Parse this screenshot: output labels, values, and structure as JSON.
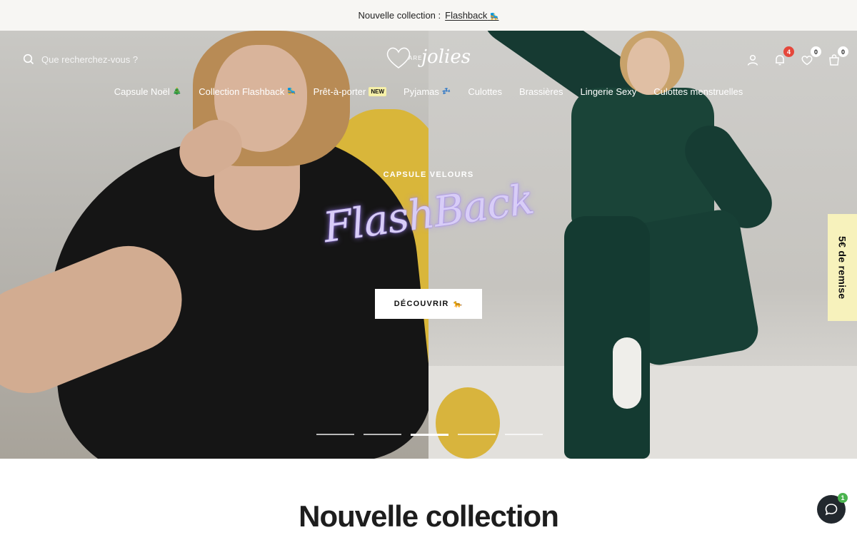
{
  "announcement": {
    "prefix": "Nouvelle collection :",
    "link": "Flashback",
    "link_emoji": "🛼"
  },
  "header": {
    "search_placeholder": "Que recherchez-vous ?",
    "logo_small": "ARE",
    "logo_script": "jolies",
    "icons": [
      {
        "name": "account-icon"
      },
      {
        "name": "notification-icon",
        "badge": "4"
      },
      {
        "name": "wishlist-icon",
        "badge": "0"
      },
      {
        "name": "cart-icon",
        "badge": "0"
      }
    ]
  },
  "nav": {
    "items": [
      {
        "label": "Capsule Noël",
        "emoji": "🎄"
      },
      {
        "label": "Collection Flashback",
        "emoji": "🛼"
      },
      {
        "label": "Prêt-à-porter",
        "tag": "NEW"
      },
      {
        "label": "Pyjamas",
        "emoji": "💤"
      },
      {
        "label": "Culottes"
      },
      {
        "label": "Brassières"
      },
      {
        "label": "Lingerie Sexy"
      },
      {
        "label": "Culottes menstruelles"
      }
    ]
  },
  "hero": {
    "eyebrow": "CAPSULE VELOURS",
    "title": "FlashBack",
    "cta_label": "DÉCOUVRIR",
    "cta_emoji": "🐆",
    "slides_count": 5,
    "active_slide": 3
  },
  "promo_tab": {
    "label": "5€ de remise"
  },
  "section": {
    "title": "Nouvelle collection"
  },
  "chat": {
    "badge": "1"
  },
  "colors": {
    "announcement_bg": "#f7f6f3",
    "promo_bg": "#f7f2bc",
    "new_tag_bg": "#f6f0a8",
    "badge_red": "#e5473b",
    "chat_bg": "#22282e",
    "chat_badge": "#4ab34f"
  }
}
